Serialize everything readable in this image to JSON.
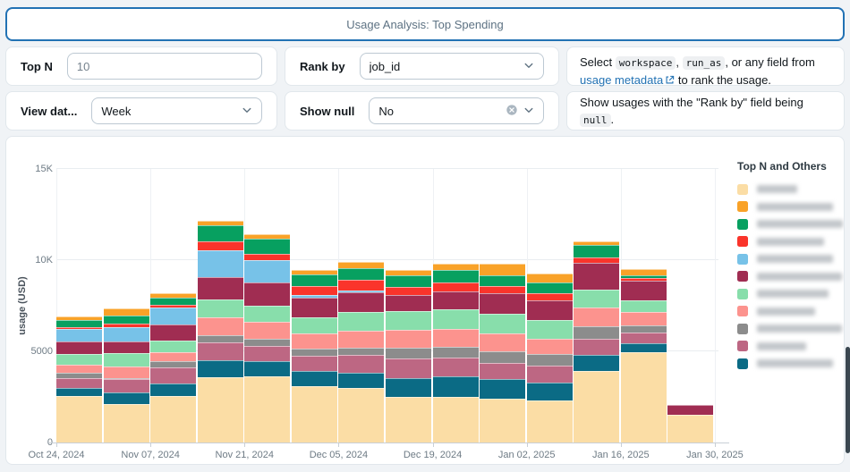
{
  "header": {
    "title": "Usage Analysis: Top Spending"
  },
  "filters": {
    "top_n": {
      "label": "Top N",
      "value": "10"
    },
    "rank_by": {
      "label": "Rank by",
      "value": "job_id"
    },
    "view_data_by": {
      "label": "View dat...",
      "value": "Week"
    },
    "show_null": {
      "label": "Show null",
      "value": "No"
    }
  },
  "help_rank_by": {
    "t1": "Select ",
    "code1": "workspace",
    "t2": ", ",
    "code2": "run_as",
    "t3": ", or any field from ",
    "link": "usage metadata",
    "t4": " to rank the usage."
  },
  "help_show_null": {
    "t1": "Show usages with the \"Rank by\" field being ",
    "code1": "null",
    "t2": "."
  },
  "chart_data": {
    "type": "bar",
    "stacked": true,
    "ylabel": "usage (USD)",
    "xlabel": "",
    "ylim": [
      0,
      15000
    ],
    "y_ticks": [
      {
        "value": 0,
        "label": "0"
      },
      {
        "value": 5000,
        "label": "5000"
      },
      {
        "value": 10000,
        "label": "10K"
      },
      {
        "value": 15000,
        "label": "15K"
      }
    ],
    "x_tick_labels": [
      "Oct 24, 2024",
      "Nov 07, 2024",
      "Nov 21, 2024",
      "Dec 05, 2024",
      "Dec 19, 2024",
      "Jan 02, 2025",
      "Jan 16, 2025",
      "Jan 30, 2025"
    ],
    "categories": [
      "Oct 24",
      "Oct 31",
      "Nov 07",
      "Nov 14",
      "Nov 21",
      "Nov 28",
      "Dec 05",
      "Dec 12",
      "Dec 19",
      "Dec 26",
      "Jan 02",
      "Jan 09",
      "Jan 16",
      "Jan 23"
    ],
    "grid": true,
    "legend_position": "right",
    "series_bottom_to_top": [
      {
        "name": "series-1-redacted",
        "color": "#FBDDA5",
        "values": [
          2565,
          2125,
          2560,
          3600,
          3650,
          3100,
          3000,
          2515,
          2485,
          2400,
          2320,
          3900,
          4950,
          1500
        ]
      },
      {
        "name": "series-11-redacted",
        "color": "#0B6B85",
        "values": [
          410,
          605,
          660,
          900,
          820,
          820,
          820,
          1030,
          1140,
          1060,
          980,
          900,
          490,
          0
        ]
      },
      {
        "name": "series-10-redacted",
        "color": "#BD6783",
        "values": [
          570,
          735,
          900,
          980,
          820,
          820,
          980,
          1060,
          1010,
          900,
          900,
          900,
          570,
          0
        ]
      },
      {
        "name": "series-9-redacted",
        "color": "#8C8C8C",
        "values": [
          280,
          60,
          330,
          410,
          410,
          410,
          410,
          570,
          590,
          650,
          650,
          650,
          410,
          0
        ]
      },
      {
        "name": "series-8-redacted",
        "color": "#FC938E",
        "values": [
          455,
          655,
          490,
          980,
          900,
          820,
          900,
          980,
          980,
          980,
          820,
          1060,
          735,
          0
        ]
      },
      {
        "name": "series-7-redacted",
        "color": "#88DEAB",
        "values": [
          560,
          735,
          650,
          980,
          900,
          900,
          1060,
          1060,
          1090,
          1060,
          1060,
          980,
          650,
          0
        ]
      },
      {
        "name": "series-6-redacted",
        "color": "#A02D52",
        "values": [
          715,
          650,
          900,
          1220,
          1300,
          1060,
          1060,
          900,
          980,
          1140,
          1060,
          1470,
          1060,
          570
        ]
      },
      {
        "name": "series-5-redacted",
        "color": "#77C2E8",
        "values": [
          685,
          770,
          900,
          1470,
          1220,
          160,
          110,
          0,
          0,
          0,
          0,
          0,
          0,
          0
        ]
      },
      {
        "name": "series-4-redacted",
        "color": "#FA342B",
        "values": [
          80,
          210,
          160,
          490,
          330,
          490,
          570,
          440,
          490,
          410,
          410,
          300,
          160,
          0
        ]
      },
      {
        "name": "series-3-redacted",
        "color": "#07A060",
        "values": [
          375,
          410,
          410,
          900,
          820,
          650,
          650,
          620,
          700,
          570,
          570,
          700,
          160,
          0
        ]
      },
      {
        "name": "series-2-redacted",
        "color": "#F9A228",
        "values": [
          230,
          410,
          250,
          250,
          250,
          250,
          330,
          290,
          360,
          650,
          490,
          150,
          330,
          0
        ]
      }
    ]
  },
  "legend": {
    "title": "Top N and Others",
    "labels_redacted": true,
    "order_colors": [
      "#FBDDA5",
      "#F9A228",
      "#07A060",
      "#FA342B",
      "#77C2E8",
      "#A02D52",
      "#88DEAB",
      "#FC938E",
      "#8C8C8C",
      "#BD6783",
      "#0B6B85"
    ],
    "redacted_widths": [
      45,
      85,
      100,
      75,
      85,
      95,
      80,
      65,
      95,
      55,
      85
    ]
  },
  "accent_colors": {
    "header_border": "#2272B4",
    "link": "#2272B4"
  }
}
